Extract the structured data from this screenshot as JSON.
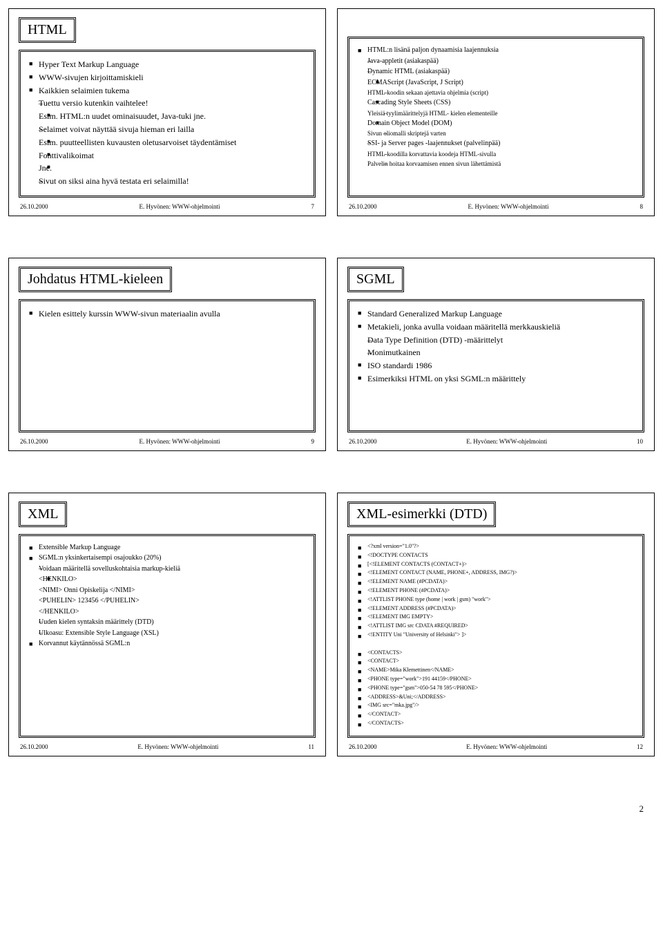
{
  "footer": {
    "date": "26.10.2000",
    "author": "E. Hyvönen: WWW-ohjelmointi"
  },
  "page_number": "2",
  "slides": {
    "s7": {
      "num": "7",
      "title": "HTML",
      "items": [
        {
          "t": "Hyper Text Markup Language",
          "l": 1
        },
        {
          "t": "WWW-sivujen kirjoittamiskieli",
          "l": 1
        },
        {
          "t": "Kaikkien selaimien tukema",
          "l": 1
        },
        {
          "t": "Tuettu versio kutenkin vaihtelee!",
          "l": 2
        },
        {
          "t": "Esim. HTML:n uudet ominaisuudet, Java-tuki jne.",
          "l": 3
        },
        {
          "t": "Selaimet voivat näyttää sivuja hieman eri lailla",
          "l": 2
        },
        {
          "t": "Esim. puutteellisten kuvausten oletusarvoiset täydentämiset",
          "l": 3
        },
        {
          "t": "Fonttivalikoimat",
          "l": 3
        },
        {
          "t": "Jne.",
          "l": 3
        },
        {
          "t": "Sivut on siksi aina hyvä testata eri selaimilla!",
          "l": 2
        }
      ]
    },
    "s8": {
      "num": "8",
      "items": [
        {
          "t": "HTML:n lisänä paljon dynaamisia laajennuksia",
          "l": 1
        },
        {
          "t": "Java-appletit (asiakaspää)",
          "l": 2
        },
        {
          "t": "Dynamic HTML (asiakaspää)",
          "l": 2
        },
        {
          "t": "ECMAScript (JavaScript, J Script)",
          "l": 3
        },
        {
          "t": "HTML-koodin sekaan ajettavia ohjelmia (script)",
          "l": 4
        },
        {
          "t": "Cascading Style Sheets (CSS)",
          "l": 3
        },
        {
          "t": "Yleisiä tyylimäärittelyjä HTML- kielen elementeille",
          "l": 4
        },
        {
          "t": "Domain Object Model (DOM)",
          "l": 3
        },
        {
          "t": "Sivun oliomalli skriptejä varten",
          "l": 4
        },
        {
          "t": "SSI- ja Server pages -laajennukset (palvelinpää)",
          "l": 2
        },
        {
          "t": "HTML-koodilla korvattavia koodeja HTML-sivulla",
          "l": 4
        },
        {
          "t": "Palvelin hoitaa korvaamisen ennen sivun lähettämistä",
          "l": 4
        }
      ]
    },
    "s9": {
      "num": "9",
      "title": "Johdatus HTML-kieleen",
      "items": [
        {
          "t": "Kielen esittely kurssin WWW-sivun materiaalin avulla",
          "l": 1
        }
      ]
    },
    "s10": {
      "num": "10",
      "title": "SGML",
      "items": [
        {
          "t": "Standard Generalized Markup Language",
          "l": 1
        },
        {
          "t": "Metakieli, jonka avulla voidaan määritellä merkkauskieliä",
          "l": 1
        },
        {
          "t": "Data Type Definition (DTD) -määrittelyt",
          "l": 2
        },
        {
          "t": "Monimutkainen",
          "l": 2
        },
        {
          "t": "ISO standardi 1986",
          "l": 1
        },
        {
          "t": "Esimerkiksi HTML on yksi SGML:n määrittely",
          "l": 1
        }
      ]
    },
    "s11": {
      "num": "11",
      "title": "XML",
      "items": [
        {
          "t": "Extensible Markup Language",
          "l": 1
        },
        {
          "t": "SGML:n  yksinkertaisempi osajoukko (20%)",
          "l": 1
        },
        {
          "t": "Voidaan määritellä sovelluskohtaisia markup-kieliä",
          "l": 2
        },
        {
          "t": "<HENKILO>",
          "l": 3
        },
        {
          "t": "<NIMI> Onni Opiskelija </NIMI>",
          "l": 0,
          "c": true
        },
        {
          "t": "<PUHELIN> 123456 </PUHELIN>",
          "l": 0,
          "c": true
        },
        {
          "t": "</HENKILO>",
          "l": 0,
          "c": true
        },
        {
          "t": "Uuden kielen syntaksin määrittely (DTD)",
          "l": 2
        },
        {
          "t": "Ulkoasu: Extensible Style Language (XSL)",
          "l": 2
        },
        {
          "t": "Korvannut käytännössä SGML:n",
          "l": 1
        }
      ]
    },
    "s12": {
      "num": "12",
      "title": "XML-esimerkki (DTD)",
      "items": [
        {
          "t": "<?xml version=\"1.0\"?>",
          "l": 1
        },
        {
          "t": "<!DOCTYPE CONTACTS",
          "l": 1
        },
        {
          "t": "[<!ELEMENT CONTACTS   (CONTACT+)>",
          "l": 1
        },
        {
          "t": "<!ELEMENT CONTACT      (NAME, PHONE+, ADDRESS, IMG?)>",
          "l": 1
        },
        {
          "t": "<!ELEMENT NAME        (#PCDATA)>",
          "l": 1
        },
        {
          "t": "<!ELEMENT PHONE       (#PCDATA)>",
          "l": 1
        },
        {
          "t": "<!ATTLIST PHONE      type (home | work | gsm) \"work\">",
          "l": 1
        },
        {
          "t": "<!ELEMENT ADDRESS  (#PCDATA)>",
          "l": 1
        },
        {
          "t": "<!ELEMENT IMG      EMPTY>",
          "l": 1
        },
        {
          "t": "<!ATTLIST IMG          src CDATA #REQUIRED>",
          "l": 1
        },
        {
          "t": "<!ENTITY  Uni         \"University of Helsinki\"> ]>",
          "l": 1
        },
        {
          "t": "",
          "l": 0,
          "blank": true
        },
        {
          "t": "<CONTACTS>",
          "l": 1
        },
        {
          "t": "<CONTACT>",
          "l": 1
        },
        {
          "t": "<NAME>Mika Klemettinen</NAME>",
          "l": 1
        },
        {
          "t": "<PHONE type=\"work\">191 44159</PHONE>",
          "l": 1
        },
        {
          "t": "<PHONE type=\"gsm\">050-54 78 595</PHONE>",
          "l": 1
        },
        {
          "t": "<ADDRESS>&Uni;</ADDRESS>",
          "l": 1
        },
        {
          "t": "<IMG src=\"mka.jpg\"/>",
          "l": 1
        },
        {
          "t": "</CONTACT>",
          "l": 1
        },
        {
          "t": "</CONTACTS>",
          "l": 1
        }
      ]
    }
  }
}
